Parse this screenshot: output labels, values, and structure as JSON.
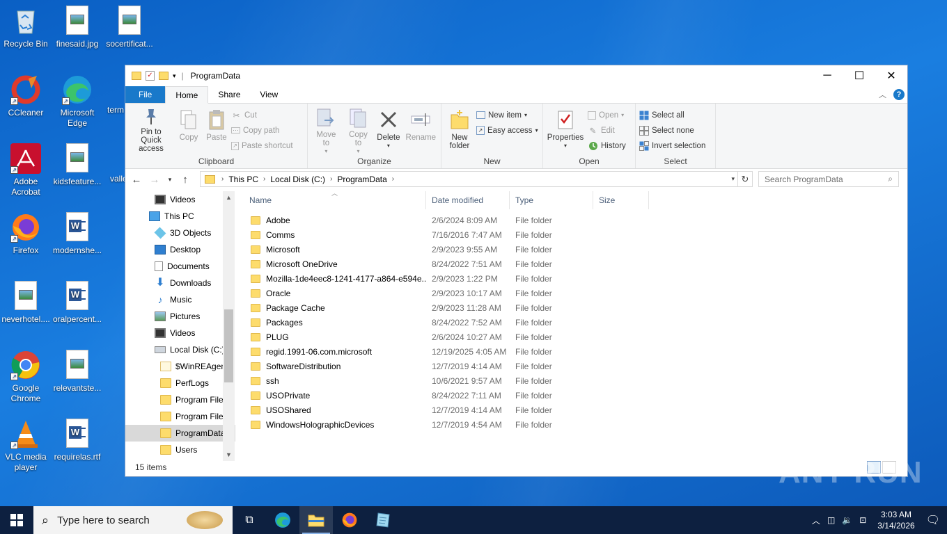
{
  "desktop": {
    "icons": [
      {
        "label": "Recycle Bin"
      },
      {
        "label": "finesaid.jpg"
      },
      {
        "label": "socertificat..."
      },
      {
        "label": "CCleaner"
      },
      {
        "label": "Microsoft Edge"
      },
      {
        "label": "term"
      },
      {
        "label": "Adobe Acrobat"
      },
      {
        "label": "kidsfeature..."
      },
      {
        "label": "valle"
      },
      {
        "label": "Firefox"
      },
      {
        "label": "modernshe..."
      },
      {
        "label": "neverhotel...."
      },
      {
        "label": "oralpercent..."
      },
      {
        "label": "Google Chrome"
      },
      {
        "label": "relevantste..."
      },
      {
        "label": "VLC media player"
      },
      {
        "label": "requirelas.rtf"
      }
    ]
  },
  "window": {
    "title": "ProgramData",
    "controls": {
      "minimize": "─",
      "maximize": "☐",
      "close": "✕"
    }
  },
  "ribbon": {
    "tabs": [
      {
        "label": "File"
      },
      {
        "label": "Home"
      },
      {
        "label": "Share"
      },
      {
        "label": "View"
      }
    ],
    "clipboard": {
      "group_label": "Clipboard",
      "pin": "Pin to Quick access",
      "copy": "Copy",
      "paste": "Paste",
      "cut": "Cut",
      "copy_path": "Copy path",
      "paste_shortcut": "Paste shortcut"
    },
    "organize": {
      "group_label": "Organize",
      "move_to": "Move to",
      "copy_to": "Copy to",
      "delete": "Delete",
      "rename": "Rename"
    },
    "new": {
      "group_label": "New",
      "new_folder": "New folder",
      "new_item": "New item",
      "easy_access": "Easy access"
    },
    "open": {
      "group_label": "Open",
      "properties": "Properties",
      "open": "Open",
      "edit": "Edit",
      "history": "History"
    },
    "select": {
      "group_label": "Select",
      "select_all": "Select all",
      "select_none": "Select none",
      "invert": "Invert selection"
    }
  },
  "address": {
    "crumbs": [
      "This PC",
      "Local Disk (C:)",
      "ProgramData"
    ],
    "search_placeholder": "Search ProgramData"
  },
  "navpane": {
    "items": [
      {
        "label": "Videos",
        "icon": "video"
      },
      {
        "label": "This PC",
        "icon": "pc"
      },
      {
        "label": "3D Objects",
        "icon": "cube"
      },
      {
        "label": "Desktop",
        "icon": "desktop"
      },
      {
        "label": "Documents",
        "icon": "doc"
      },
      {
        "label": "Downloads",
        "icon": "download"
      },
      {
        "label": "Music",
        "icon": "music"
      },
      {
        "label": "Pictures",
        "icon": "pictures"
      },
      {
        "label": "Videos",
        "icon": "video"
      },
      {
        "label": "Local Disk (C:)",
        "icon": "disk"
      },
      {
        "label": "$WinREAgent",
        "icon": "folder"
      },
      {
        "label": "PerfLogs",
        "icon": "folder"
      },
      {
        "label": "Program Files",
        "icon": "folder"
      },
      {
        "label": "Program Files",
        "icon": "folder"
      },
      {
        "label": "ProgramData",
        "icon": "folder"
      },
      {
        "label": "Users",
        "icon": "folder"
      }
    ]
  },
  "filelist": {
    "columns": [
      "Name",
      "Date modified",
      "Type",
      "Size"
    ],
    "rows": [
      {
        "name": "Adobe",
        "date": "2/6/2024 8:09 AM",
        "type": "File folder"
      },
      {
        "name": "Comms",
        "date": "7/16/2016 7:47 AM",
        "type": "File folder"
      },
      {
        "name": "Microsoft",
        "date": "2/9/2023 9:55 AM",
        "type": "File folder"
      },
      {
        "name": "Microsoft OneDrive",
        "date": "8/24/2022 7:51 AM",
        "type": "File folder"
      },
      {
        "name": "Mozilla-1de4eec8-1241-4177-a864-e594e...",
        "date": "2/9/2023 1:22 PM",
        "type": "File folder"
      },
      {
        "name": "Oracle",
        "date": "2/9/2023 10:17 AM",
        "type": "File folder"
      },
      {
        "name": "Package Cache",
        "date": "2/9/2023 11:28 AM",
        "type": "File folder"
      },
      {
        "name": "Packages",
        "date": "8/24/2022 7:52 AM",
        "type": "File folder"
      },
      {
        "name": "PLUG",
        "date": "2/6/2024 10:27 AM",
        "type": "File folder"
      },
      {
        "name": "regid.1991-06.com.microsoft",
        "date": "12/19/2025 4:05 AM",
        "type": "File folder"
      },
      {
        "name": "SoftwareDistribution",
        "date": "12/7/2019 4:14 AM",
        "type": "File folder"
      },
      {
        "name": "ssh",
        "date": "10/6/2021 9:57 AM",
        "type": "File folder"
      },
      {
        "name": "USOPrivate",
        "date": "8/24/2022 7:11 AM",
        "type": "File folder"
      },
      {
        "name": "USOShared",
        "date": "12/7/2019 4:14 AM",
        "type": "File folder"
      },
      {
        "name": "WindowsHolographicDevices",
        "date": "12/7/2019 4:54 AM",
        "type": "File folder"
      }
    ],
    "status": "15 items"
  },
  "taskbar": {
    "search_placeholder": "Type here to search",
    "time": "3:03 AM",
    "date": "3/14/2026"
  },
  "watermark": "ANY RUN"
}
